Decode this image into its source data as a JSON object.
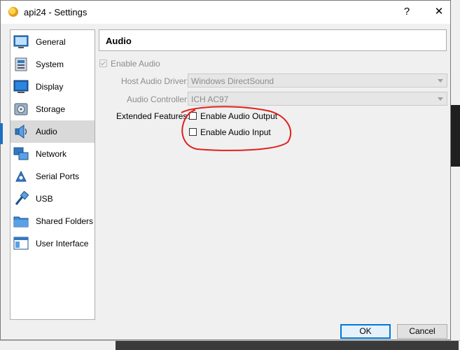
{
  "window": {
    "title": "api24 - Settings",
    "help_glyph": "?",
    "close_glyph": "✕"
  },
  "sidebar": {
    "items": [
      {
        "label": "General",
        "icon": "general-icon"
      },
      {
        "label": "System",
        "icon": "system-icon"
      },
      {
        "label": "Display",
        "icon": "display-icon"
      },
      {
        "label": "Storage",
        "icon": "storage-icon"
      },
      {
        "label": "Audio",
        "icon": "audio-icon",
        "active": true
      },
      {
        "label": "Network",
        "icon": "network-icon"
      },
      {
        "label": "Serial Ports",
        "icon": "serial-ports-icon"
      },
      {
        "label": "USB",
        "icon": "usb-icon"
      },
      {
        "label": "Shared Folders",
        "icon": "shared-folders-icon"
      },
      {
        "label": "User Interface",
        "icon": "user-interface-icon"
      }
    ]
  },
  "page": {
    "title": "Audio",
    "enable_audio": {
      "label": "Enable Audio",
      "checked": true,
      "enabled": false
    },
    "host_driver": {
      "label": "Host Audio Driver:",
      "value": "Windows DirectSound"
    },
    "controller": {
      "label": "Audio Controller:",
      "value": "ICH AC97"
    },
    "extended_features_label": "Extended Features:",
    "enable_output": {
      "label": "Enable Audio Output",
      "checked": false
    },
    "enable_input": {
      "label": "Enable Audio Input",
      "checked": false
    }
  },
  "buttons": {
    "ok": "OK",
    "cancel": "Cancel"
  },
  "colors": {
    "accent": "#0078d7",
    "annotation": "#e0201c"
  }
}
